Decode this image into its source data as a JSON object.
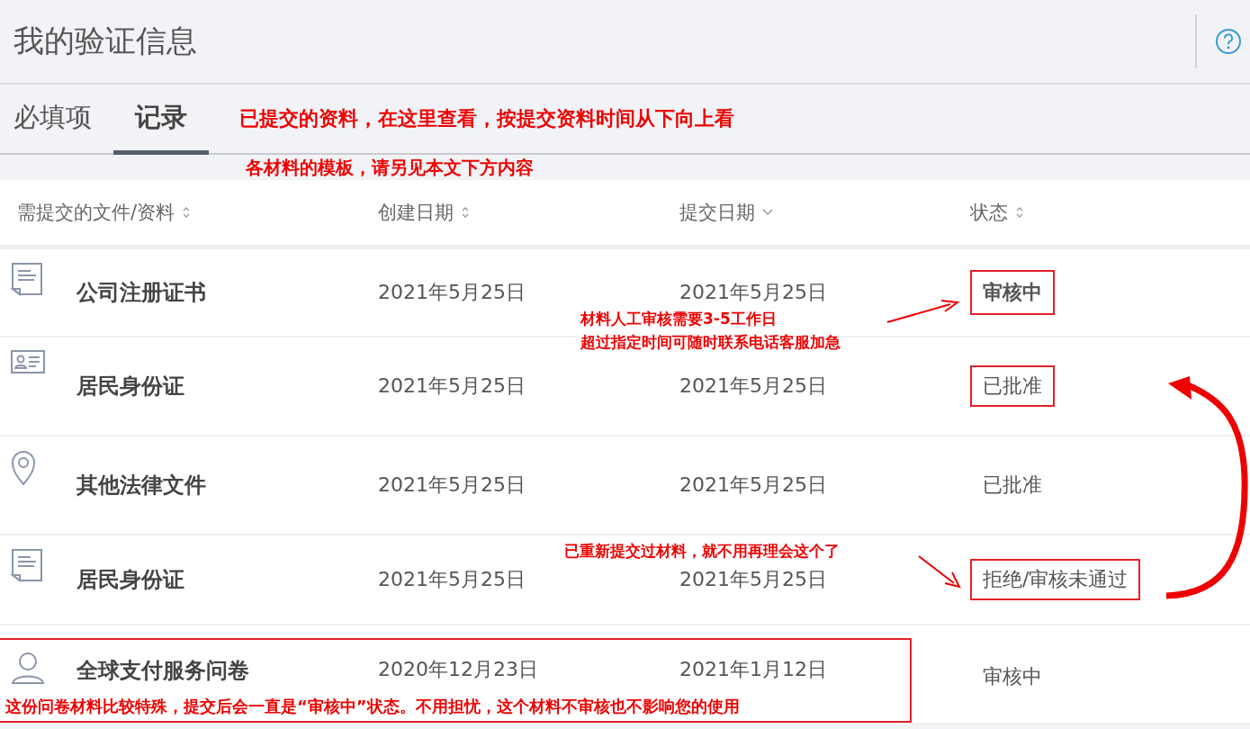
{
  "header": {
    "title": "我的验证信息"
  },
  "tabs": [
    {
      "label": "必填项",
      "selected": false
    },
    {
      "label": "记录",
      "selected": true
    }
  ],
  "notes": [
    "已提交的资料，在这里查看，按提交资料时间从下向上看",
    "各材料的模板，请另见本文下方内容"
  ],
  "table": {
    "columns": [
      {
        "label": "需提交的文件/资料",
        "kind": "sortable"
      },
      {
        "label": "创建日期",
        "kind": "sortable"
      },
      {
        "label": "提交日期",
        "kind": "sorted"
      },
      {
        "label": "状态",
        "kind": "sortable"
      }
    ],
    "rows": [
      {
        "kind": "document",
        "name": "公司注册证书",
        "created": "2021年5月25日",
        "submitted": "2021年5月25日",
        "status": "审核中",
        "status_boxed": true,
        "status_bold": true
      },
      {
        "kind": "id-card",
        "name": "居民身份证",
        "created": "2021年5月25日",
        "submitted": "2021年5月25日",
        "status": "已批准",
        "status_boxed": true,
        "status_bold": false
      },
      {
        "kind": "pin",
        "name": "其他法律文件",
        "created": "2021年5月25日",
        "submitted": "2021年5月25日",
        "status": "已批准",
        "status_boxed": false,
        "status_bold": false
      },
      {
        "kind": "document",
        "name": "居民身份证",
        "created": "2021年5月25日",
        "submitted": "2021年5月25日",
        "status": "拒绝/审核未通过",
        "status_boxed": true,
        "status_bold": false
      },
      {
        "kind": "person",
        "name": "全球支付服务问卷",
        "created": "2020年12月23日",
        "submitted": "2021年1月12日",
        "status": "审核中",
        "status_boxed": false,
        "status_bold": false,
        "boxed": true,
        "note": "这份问卷材料比较特殊，提交后会一直是“审核中”状态。不用担忧，这个材料不审核也不影响您的使用"
      }
    ]
  },
  "callouts": [
    {
      "lines": [
        "材料人工审核需要3-5工作日",
        "超过指定时间可随时联系电话客服加急"
      ]
    },
    {
      "lines": [
        "已重新提交过材料，就不用再理会这个了"
      ]
    }
  ]
}
